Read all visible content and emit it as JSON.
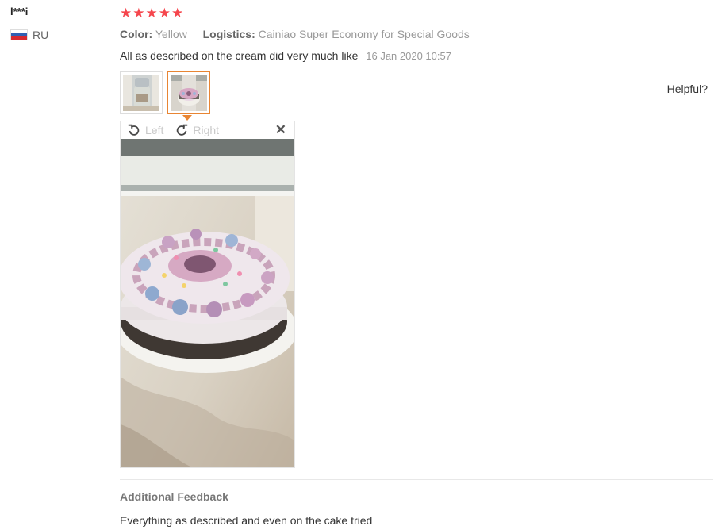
{
  "user": {
    "name": "l***i",
    "country_code": "RU",
    "country_flag": "russia-flag-icon"
  },
  "rating": {
    "stars": 5,
    "max": 5,
    "star_color": "#f5464d"
  },
  "attributes": {
    "color_label": "Color:",
    "color_value": "Yellow",
    "logistics_label": "Logistics:",
    "logistics_value": "Cainiao Super Economy for Special Goods"
  },
  "review": {
    "text": "All as described on the cream did very much like",
    "date": "16 Jan 2020 10:57"
  },
  "helpful_label": "Helpful?",
  "viewer": {
    "left_label": "Left",
    "right_label": "Right",
    "close_icon": "close-icon",
    "selected_thumbnail": 2
  },
  "additional": {
    "title": "Additional Feedback",
    "text": "Everything as described and even on the cake tried"
  },
  "colors": {
    "active_border": "#e88533"
  }
}
